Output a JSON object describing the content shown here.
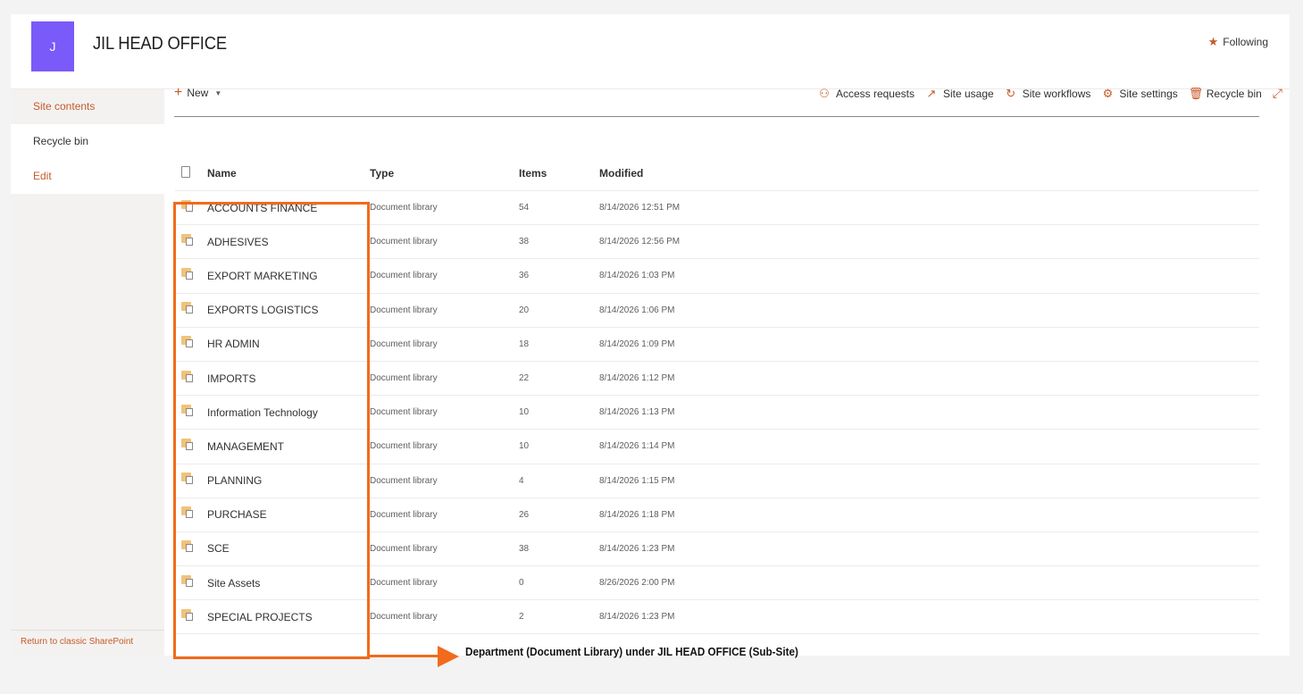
{
  "site": {
    "logo_letter": "J",
    "title": "JIL HEAD OFFICE",
    "following_label": "Following"
  },
  "leftnav": {
    "items": [
      {
        "label": "Site contents"
      },
      {
        "label": "Recycle bin"
      },
      {
        "label": "Edit"
      }
    ],
    "return_label": "Return to classic SharePoint"
  },
  "cmdbar": {
    "new_label": "New",
    "actions": [
      {
        "label": "Access requests",
        "icon": "people-icon"
      },
      {
        "label": "Site usage",
        "icon": "chart-icon"
      },
      {
        "label": "Site workflows",
        "icon": "workflow-icon"
      },
      {
        "label": "Site settings",
        "icon": "gear-icon"
      },
      {
        "label": "Recycle bin",
        "icon": "trash-icon"
      }
    ]
  },
  "table": {
    "headers": {
      "name": "Name",
      "type": "Type",
      "items": "Items",
      "modified": "Modified"
    },
    "rows": [
      {
        "name": "ACCOUNTS FINANCE",
        "type": "Document library",
        "items": "54",
        "modified": "8/14/2026 12:51 PM"
      },
      {
        "name": "ADHESIVES",
        "type": "Document library",
        "items": "38",
        "modified": "8/14/2026 12:56 PM"
      },
      {
        "name": "EXPORT MARKETING",
        "type": "Document library",
        "items": "36",
        "modified": "8/14/2026 1:03 PM"
      },
      {
        "name": "EXPORTS LOGISTICS",
        "type": "Document library",
        "items": "20",
        "modified": "8/14/2026 1:06 PM"
      },
      {
        "name": "HR ADMIN",
        "type": "Document library",
        "items": "18",
        "modified": "8/14/2026 1:09 PM"
      },
      {
        "name": "IMPORTS",
        "type": "Document library",
        "items": "22",
        "modified": "8/14/2026 1:12 PM"
      },
      {
        "name": "Information Technology",
        "type": "Document library",
        "items": "10",
        "modified": "8/14/2026 1:13 PM"
      },
      {
        "name": "MANAGEMENT",
        "type": "Document library",
        "items": "10",
        "modified": "8/14/2026 1:14 PM"
      },
      {
        "name": "PLANNING",
        "type": "Document library",
        "items": "4",
        "modified": "8/14/2026 1:15 PM"
      },
      {
        "name": "PURCHASE",
        "type": "Document library",
        "items": "26",
        "modified": "8/14/2026 1:18 PM"
      },
      {
        "name": "SCE",
        "type": "Document library",
        "items": "38",
        "modified": "8/14/2026 1:23 PM"
      },
      {
        "name": "Site Assets",
        "type": "Document library",
        "items": "0",
        "modified": "8/26/2026 2:00 PM"
      },
      {
        "name": "SPECIAL PROJECTS",
        "type": "Document library",
        "items": "2",
        "modified": "8/14/2026 1:23 PM"
      }
    ]
  },
  "annotation": {
    "text": "Department (Document Library) under JIL HEAD OFFICE (Sub-Site)"
  },
  "colors": {
    "accent": "#c65b29",
    "logo": "#7a5af8",
    "annotation": "#f26a1b"
  }
}
